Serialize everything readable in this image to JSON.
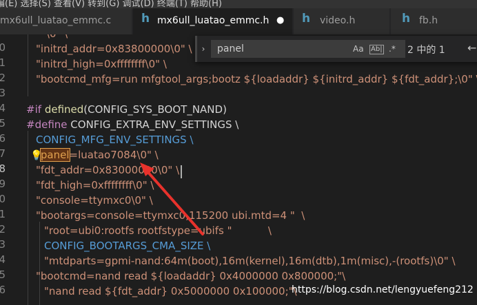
{
  "menubar": {
    "text": "编(E)  选择(S)  查看(V)  转到(G)  调试(D)  终端(T)  帮助(H)"
  },
  "tabs": [
    {
      "icon": "h",
      "label": "mx6ull_luatao_emmc.c",
      "active": false
    },
    {
      "icon": "h",
      "label": "mx6ull_luatao_emmc.h",
      "active": true,
      "modified_dot": "●"
    },
    {
      "icon": "h",
      "label": "video.h",
      "active": false
    },
    {
      "icon": "h",
      "label": "fb.h",
      "active": false
    }
  ],
  "line_numbers": [
    "",
    "0",
    "1",
    "2",
    "3",
    "4",
    "5",
    "6",
    "7",
    "8",
    "9",
    "0",
    "1",
    "2",
    "3",
    "4",
    "5",
    "6",
    "7",
    "8"
  ],
  "code": {
    "l0": "\"\\0\" \\",
    "l1": "\"initrd_addr=0x83800000\\0\" \\",
    "l2": "\"initrd_high=0xffffffff\\0\" \\",
    "l3": "\"bootcmd_mfg=run mfgtool_args;bootz ${loadaddr} ${initrd_addr} ${fdt_addr};\\0\" \\",
    "l5_kw": "#if",
    "l5_fn": "defined",
    "l5_rest": "(CONFIG_SYS_BOOT_NAND)",
    "l6_kw": "#define",
    "l6_rest": " CONFIG_EXTRA_ENV_SETTINGS \\",
    "l7": "CONFIG_MFG_ENV_SETTINGS \\",
    "l8_q": "\"",
    "l8_hl": "panel",
    "l8_rest": "=luatao7084\\0\" \\",
    "l9": "\"fdt_addr=0x83000000\\0\" \\",
    "l10": "\"fdt_high=0xffffffff\\0\" \\",
    "l11": "\"console=ttymxc0\\0\" \\",
    "l12": "\"bootargs=console=ttymxc0,115200 ubi.mtd=4 \"  \\",
    "l13": "\"root=ubi0:rootfs rootfstype=ubifs \"           \\",
    "l14": "CONFIG_BOOTARGS_CMA_SIZE \\",
    "l15": "\"mtdparts=gpmi-nand:64m(boot),16m(kernel),16m(dtb),1m(misc),-(rootfs)\\0\" \\",
    "l16": "\"bootcmd=nand read ${loadaddr} 0x4000000 0x800000;\"\\",
    "l17": "\"nand read ${fdt_addr} 0x5000000 0x100000;\"\\"
  },
  "find": {
    "toggle": "›",
    "query": "panel",
    "opt_case": "Aa",
    "opt_word": "Ab|",
    "opt_regex": ".*",
    "count": "2 中的 1",
    "prev": "←"
  },
  "icons": {
    "lightbulb": "lightbulb-icon",
    "arrow": "red-annotation-arrow"
  },
  "colors": {
    "annotation": "#e8322c",
    "highlight": "#e2a24f"
  },
  "watermark": "https://blog.csdn.net/lengyuefeng212"
}
